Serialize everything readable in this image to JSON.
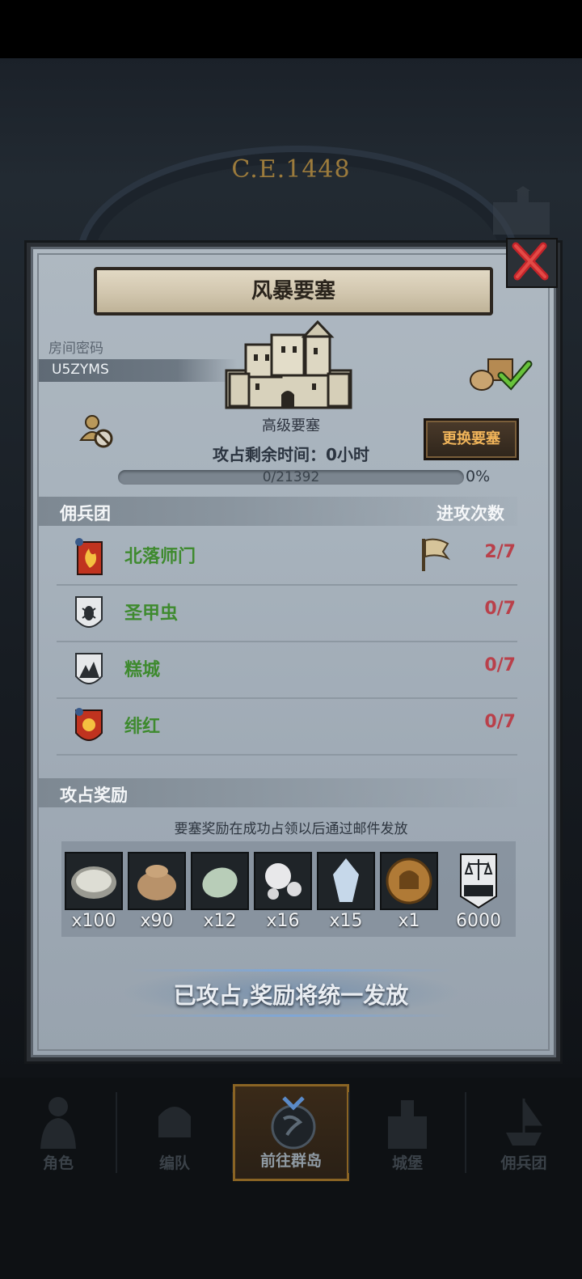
{
  "background": {
    "era_label": "C.E.1448"
  },
  "dialog": {
    "title": "风暴要塞",
    "room_code_label": "房间密码",
    "room_code": "U5ZYMS",
    "fortress_type": "高级要塞",
    "time_remaining_label": "攻占剩余时间：",
    "time_remaining_value": "0小时",
    "change_button_label": "更换要塞",
    "progress": {
      "text": "0/21392",
      "percent_text": "0%",
      "fraction": 0.0
    }
  },
  "mercenaries": {
    "header": "佣兵团",
    "attacks_header": "进攻次数",
    "rows": [
      {
        "name": "北落师门",
        "count": "2/7",
        "emblem": "red-flame-banner-icon",
        "has_flag": true
      },
      {
        "name": "圣甲虫",
        "count": "0/7",
        "emblem": "white-scarab-shield-icon",
        "has_flag": false
      },
      {
        "name": "糕城",
        "count": "0/7",
        "emblem": "white-mountain-shield-icon",
        "has_flag": false
      },
      {
        "name": "绯红",
        "count": "0/7",
        "emblem": "red-sun-shield-icon",
        "has_flag": false
      }
    ]
  },
  "rewards": {
    "header": "攻占奖励",
    "note": "要塞奖励在成功占领以后通过邮件发放",
    "items": [
      {
        "icon": "oyster-icon",
        "qty": "x100"
      },
      {
        "icon": "coin-sack-icon",
        "qty": "x90"
      },
      {
        "icon": "jade-stone-icon",
        "qty": "x12"
      },
      {
        "icon": "pearl-icon",
        "qty": "x16"
      },
      {
        "icon": "crystal-icon",
        "qty": "x15"
      },
      {
        "icon": "knight-helmet-coin-icon",
        "qty": "x1"
      },
      {
        "icon": "justice-badge-icon",
        "qty": "6000"
      }
    ]
  },
  "status_text": "已攻占,奖励将统一发放",
  "nav": [
    {
      "label": "角色",
      "icon": "knight-character-icon",
      "active": false
    },
    {
      "label": "编队",
      "icon": "formation-helmet-icon",
      "active": false
    },
    {
      "label": "前往群岛",
      "icon": "islands-compass-icon",
      "active": true
    },
    {
      "label": "城堡",
      "icon": "castle-icon",
      "active": false
    },
    {
      "label": "佣兵团",
      "icon": "mercenary-ship-icon",
      "active": false
    }
  ],
  "colors": {
    "merc_name": "#3e8a2e",
    "attack_count": "#b9404a",
    "button_text": "#f0b45a"
  }
}
